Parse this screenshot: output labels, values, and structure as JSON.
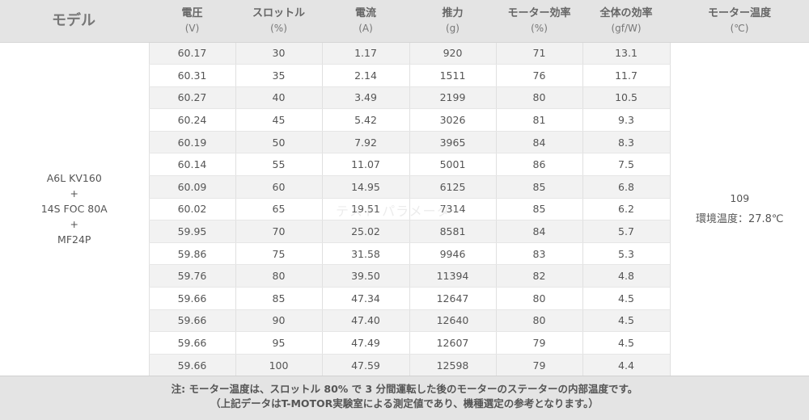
{
  "header": {
    "model": "モデル",
    "columns": [
      {
        "label": "電圧",
        "unit": "(V)"
      },
      {
        "label": "スロットル",
        "unit": "(%)"
      },
      {
        "label": "電流",
        "unit": "(A)"
      },
      {
        "label": "推力",
        "unit": "(g)"
      },
      {
        "label": "モーター効率",
        "unit": "(%)"
      },
      {
        "label": "全体の効率",
        "unit": "(gf/W)"
      },
      {
        "label": "モーター温度",
        "unit": "(℃)"
      }
    ]
  },
  "model": {
    "line1": "A6L KV160",
    "plus1": "+",
    "line2": "14S FOC 80A",
    "plus2": "+",
    "line3": "MF24P"
  },
  "temperature": {
    "value": "109",
    "ambient": "環境温度：27.8℃"
  },
  "rows": [
    [
      "60.17",
      "30",
      "1.17",
      "920",
      "71",
      "13.1"
    ],
    [
      "60.31",
      "35",
      "2.14",
      "1511",
      "76",
      "11.7"
    ],
    [
      "60.27",
      "40",
      "3.49",
      "2199",
      "80",
      "10.5"
    ],
    [
      "60.24",
      "45",
      "5.42",
      "3026",
      "81",
      "9.3"
    ],
    [
      "60.19",
      "50",
      "7.92",
      "3965",
      "84",
      "8.3"
    ],
    [
      "60.14",
      "55",
      "11.07",
      "5001",
      "86",
      "7.5"
    ],
    [
      "60.09",
      "60",
      "14.95",
      "6125",
      "85",
      "6.8"
    ],
    [
      "60.02",
      "65",
      "19.51",
      "7314",
      "85",
      "6.2"
    ],
    [
      "59.95",
      "70",
      "25.02",
      "8581",
      "84",
      "5.7"
    ],
    [
      "59.86",
      "75",
      "31.58",
      "9946",
      "83",
      "5.3"
    ],
    [
      "59.76",
      "80",
      "39.50",
      "11394",
      "82",
      "4.8"
    ],
    [
      "59.66",
      "85",
      "47.34",
      "12647",
      "80",
      "4.5"
    ],
    [
      "59.66",
      "90",
      "47.40",
      "12640",
      "80",
      "4.5"
    ],
    [
      "59.66",
      "95",
      "47.49",
      "12607",
      "79",
      "4.5"
    ],
    [
      "59.66",
      "100",
      "47.59",
      "12598",
      "79",
      "4.4"
    ]
  ],
  "note": {
    "line1": "注: モーター温度は、スロットル 80% で 3 分間運転した後のモーターのステーターの内部温度です。",
    "line2": "（上記データはT-MOTOR実験室による測定値であり、機種選定の参考となります。）"
  },
  "watermark": "テスト パラメーター"
}
